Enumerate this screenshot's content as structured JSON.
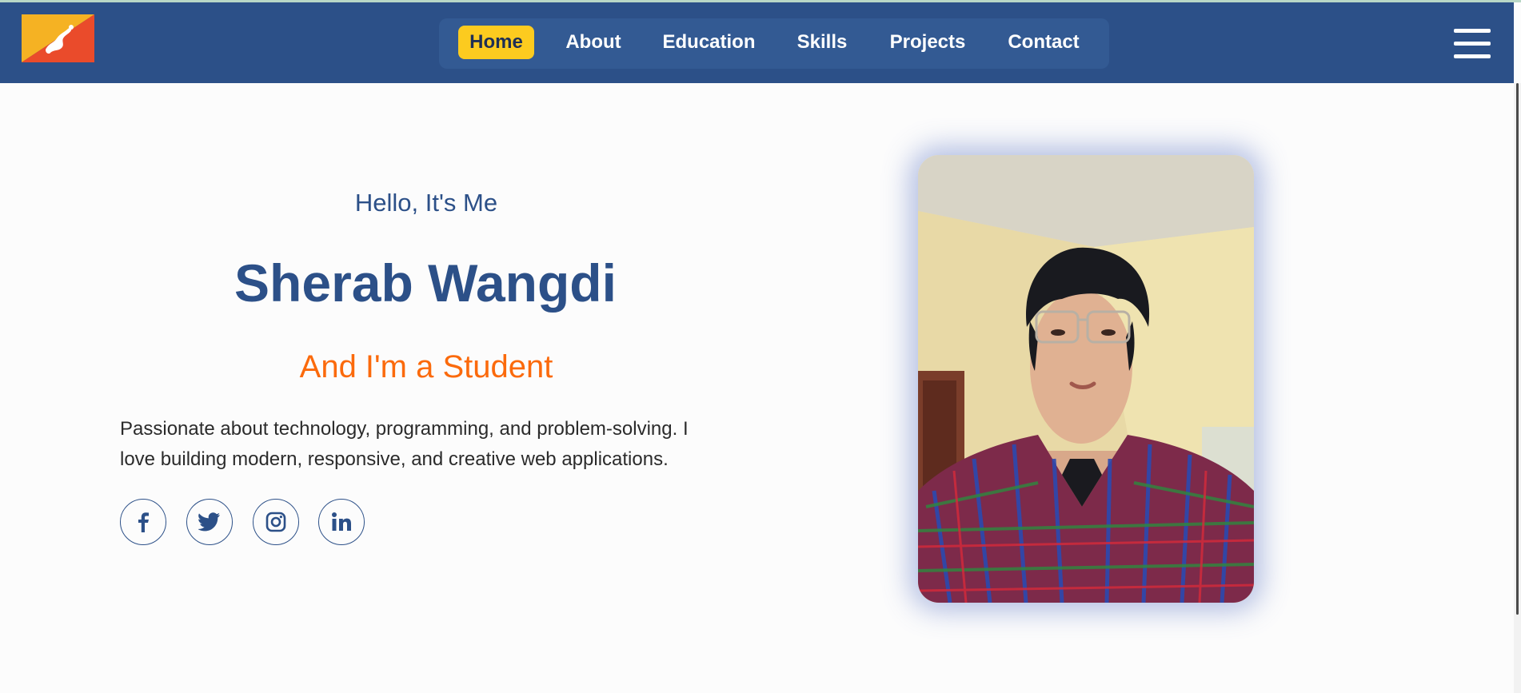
{
  "nav": {
    "flag_icon": "bhutan-flag-icon",
    "links": [
      {
        "label": "Home",
        "active": true
      },
      {
        "label": "About",
        "active": false
      },
      {
        "label": "Education",
        "active": false
      },
      {
        "label": "Skills",
        "active": false
      },
      {
        "label": "Projects",
        "active": false
      },
      {
        "label": "Contact",
        "active": false
      }
    ],
    "menu_icon": "hamburger-menu-icon"
  },
  "hero": {
    "greeting": "Hello, It's Me",
    "name": "Sherab Wangdi",
    "role": "And I'm a Student",
    "bio": "Passionate about technology, programming, and problem-solving. I love building modern, responsive, and creative web applications.",
    "social": [
      "facebook-icon",
      "twitter-icon",
      "instagram-icon",
      "linkedin-icon"
    ],
    "photo": "profile-photo"
  },
  "colors": {
    "navbar": "#2c5088",
    "active_tab": "#fccb1f",
    "accent": "#fb6a0c",
    "primary_text": "#2c5088"
  }
}
